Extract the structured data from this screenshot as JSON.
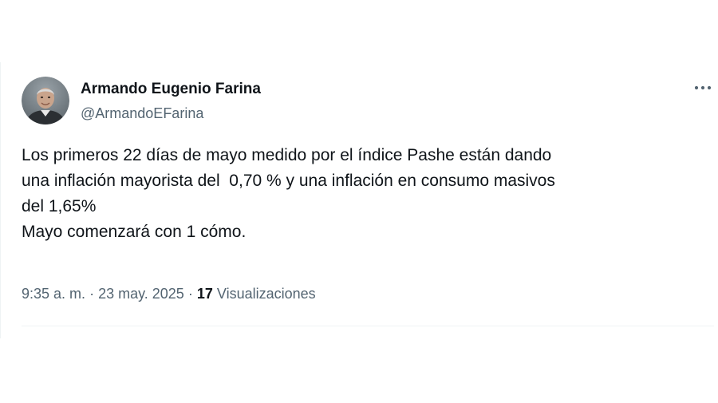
{
  "author": {
    "display_name": "Armando Eugenio Farina",
    "handle": "@ArmandoEFarina"
  },
  "tweet": {
    "lines": [
      "Los primeros 22 días de mayo medido por el índice Pashe están dando",
      "una inflación mayorista del  0,70 % y una inflación en consumo masivos",
      "del 1,65%",
      "Mayo comenzará con 1 cómo."
    ]
  },
  "meta": {
    "time": "9:35 a. m.",
    "separator": "·",
    "date": "23 may. 2025",
    "views_count": "17",
    "views_label": "Visualizaciones"
  },
  "icons": {
    "more": "more-horizontal-icon"
  },
  "colors": {
    "text_primary": "#0f1419",
    "text_secondary": "#536471",
    "divider": "#eff3f4"
  }
}
